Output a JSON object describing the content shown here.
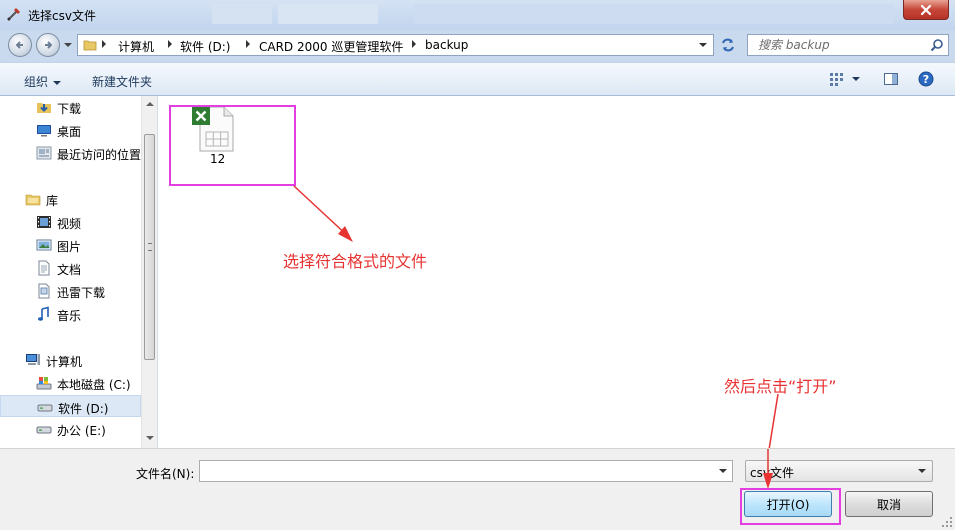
{
  "window": {
    "title": "选择csv文件",
    "close_label": "×"
  },
  "address": {
    "crumbs": [
      "计算机",
      "软件 (D:)",
      "CARD 2000 巡更管理软件",
      "backup"
    ],
    "search_placeholder": "搜索 backup"
  },
  "toolbar": {
    "organize": "组织",
    "new_folder": "新建文件夹",
    "help": "?"
  },
  "nav": {
    "favorites": [
      {
        "label": "下载"
      },
      {
        "label": "桌面"
      },
      {
        "label": "最近访问的位置"
      }
    ],
    "libraries_label": "库",
    "libraries": [
      {
        "label": "视频"
      },
      {
        "label": "图片"
      },
      {
        "label": "文档"
      },
      {
        "label": "迅雷下载"
      },
      {
        "label": "音乐"
      }
    ],
    "computer_label": "计算机",
    "drives": [
      {
        "label": "本地磁盘 (C:)"
      },
      {
        "label": "软件 (D:)",
        "selected": true
      },
      {
        "label": "办公 (E:)"
      }
    ]
  },
  "files": [
    {
      "name": "12",
      "type": "csv"
    }
  ],
  "annotations": {
    "select_file": "选择符合格式的文件",
    "then_open": "然后点击“打开”"
  },
  "bottom": {
    "filename_label": "文件名(N):",
    "filename_value": "",
    "filetype_value": "csv文件",
    "open_button": "打开(O)",
    "cancel_button": "取消"
  },
  "colors": {
    "highlight": "#e33ee0",
    "annotation": "#e83333",
    "excel_green": "#2e7d32"
  }
}
